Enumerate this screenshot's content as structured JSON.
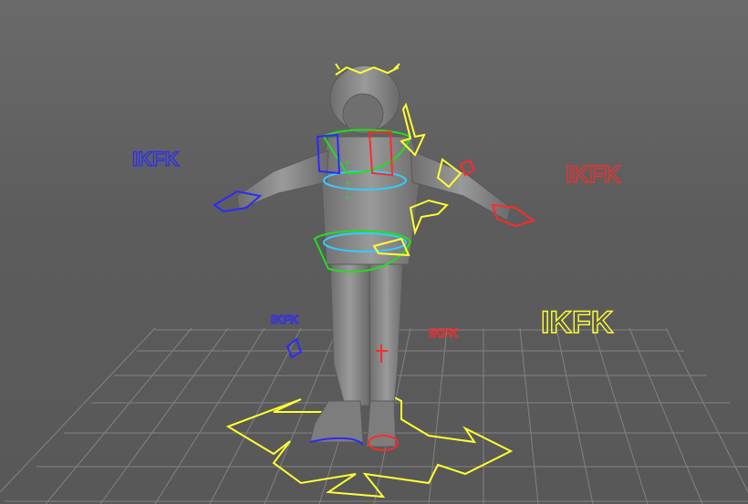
{
  "viewport": {
    "name": "3D viewport",
    "background": "#5d5d5d"
  },
  "labels": {
    "ikfk_left_arm": "IKFK",
    "ikfk_right_arm": "IKFK",
    "ikfk_left_leg": "IKFK",
    "ikfk_right_leg": "IKFK",
    "ikfk_main": "IKFK"
  },
  "colors": {
    "left_side": "#2a2aff",
    "right_side": "#ff2a2a",
    "center": "#ffff33",
    "torso_cyan": "#33ccff",
    "torso_green": "#22dd22",
    "grid": "#8a8a8a",
    "body": "#8c8c8c"
  }
}
